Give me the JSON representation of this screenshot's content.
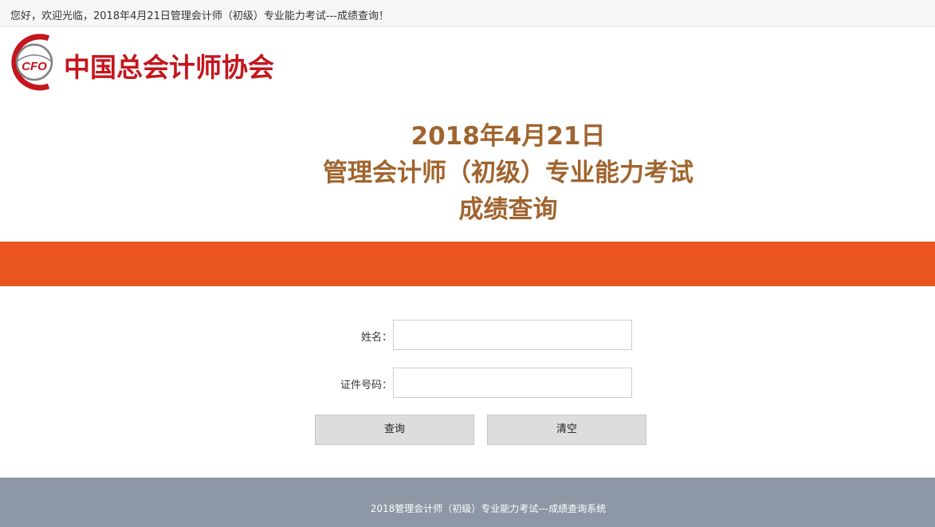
{
  "topbar": {
    "welcome_text": "您好，欢迎光临，2018年4月21日管理会计师（初级）专业能力考试---成绩查询！"
  },
  "logo": {
    "badge_text": "CFO",
    "name": "中国总会计师协会",
    "colors": {
      "red": "#c4161c",
      "gray": "#7f7f7f"
    }
  },
  "title": {
    "line1": "2018年4月21日",
    "line2": "管理会计师（初级）专业能力考试",
    "line3": "成绩查询"
  },
  "banner": {
    "color": "#e95420"
  },
  "form": {
    "name_label": "姓名：",
    "name_value": "",
    "id_label": "证件号码：",
    "id_value": "",
    "query_button": "查询",
    "clear_button": "清空"
  },
  "footer": {
    "text": "2018管理会计师（初级）专业能力考试---成绩查询系统"
  },
  "colors": {
    "title": "#a0642e",
    "footer_bg": "#8d97a5",
    "button_bg": "#dddddd"
  }
}
